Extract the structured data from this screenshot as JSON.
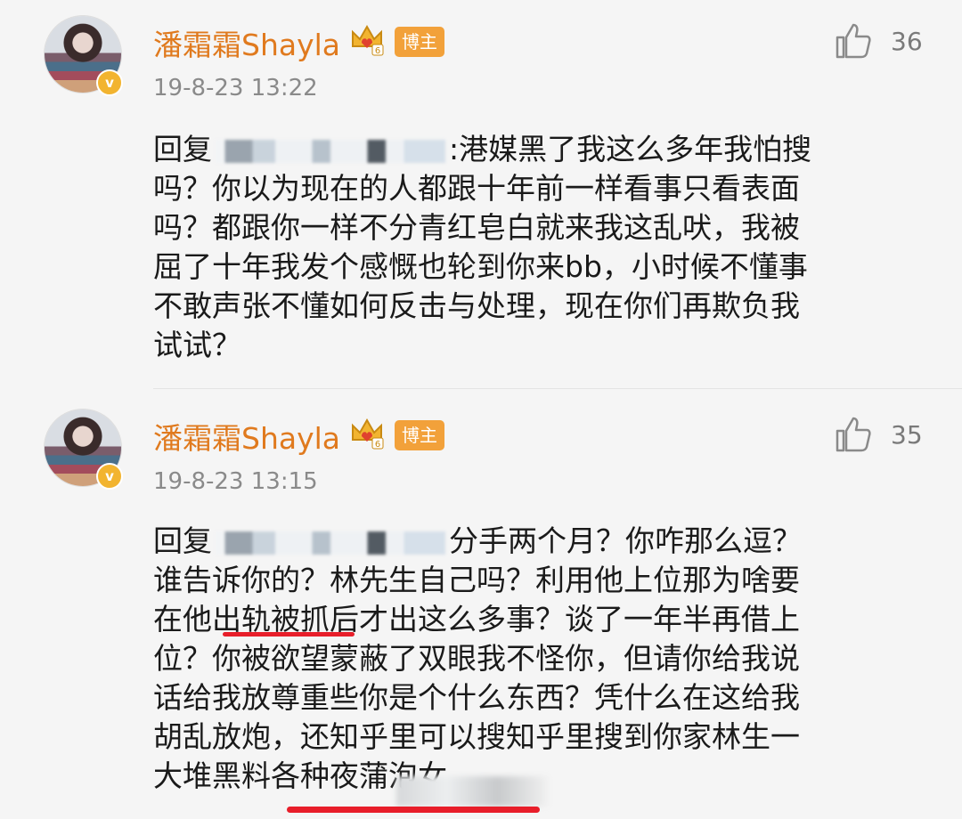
{
  "comments": [
    {
      "user": "潘霜霜Shayla",
      "badge": "博主",
      "verified_mark": "v",
      "crown_level": "6",
      "time": "19-8-23 13:22",
      "likes": "36",
      "lines": [
        {
          "pre": "回复",
          "post": ":港媒黑了我这么多年我怕搜"
        },
        {
          "text": "吗？你以为现在的人都跟十年前一样看事只看表面"
        },
        {
          "text": "吗？都跟你一样不分青红皂白就来我这乱吠，我被"
        },
        {
          "text": "屈了十年我发个感慨也轮到你来bb，小时候不懂事"
        },
        {
          "text": "不敢声张不懂如何反击与处理，现在你们再欺负我"
        },
        {
          "text": "试试？"
        }
      ]
    },
    {
      "user": "潘霜霜Shayla",
      "badge": "博主",
      "verified_mark": "v",
      "crown_level": "6",
      "time": "19-8-23 13:15",
      "likes": "35",
      "lines": [
        {
          "pre": "回复",
          "post": "分手两个月？你咋那么逗？"
        },
        {
          "text": "谁告诉你的？林先生自己吗？利用他上位那为啥要"
        },
        {
          "text": "在他出轨被抓后才出这么多事？谈了一年半再借上"
        },
        {
          "text": "位？你被欲望蒙蔽了双眼我不怪你，但请你给我说"
        },
        {
          "text": "话给我放尊重些你是个什么东西？凭什么在这给我"
        },
        {
          "text": "胡乱放炮，还知乎里可以搜知乎里搜到你家林生一"
        },
        {
          "text": "大堆黑料各种夜蒲泡女"
        }
      ]
    }
  ],
  "colors": {
    "username": "#e07a1e",
    "badge": "#f2a13a",
    "annotation_red": "#e81e2a",
    "timestamp": "#8a8a8a"
  },
  "icons": [
    "thumbs-up-icon",
    "crown-icon",
    "verified-icon"
  ]
}
